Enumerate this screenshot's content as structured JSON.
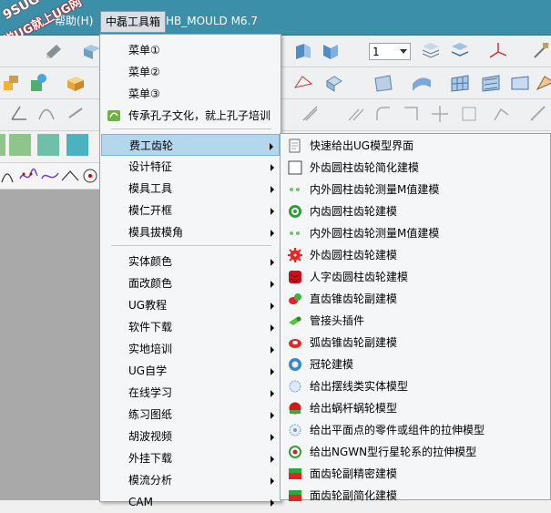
{
  "watermark": {
    "brand": "9SUG",
    "slogan": "学UG就上UG网"
  },
  "menubar": {
    "help": "帮助(H)",
    "toolbox": "中磊工具箱",
    "title": "HB_MOULD M6.7"
  },
  "toolbar": {
    "layer_value": "1"
  },
  "swatch_colors": [
    "#8fc58b",
    "#6ec0a8",
    "#4ab2c0",
    "#5aa8d0"
  ],
  "main_menu": {
    "top_items": [
      "菜单①",
      "菜单②",
      "菜单③"
    ],
    "promo": "传承孔子文化，就上孔子培训",
    "group1": [
      {
        "label": "费工齿轮",
        "highlight": true
      },
      {
        "label": "设计特征"
      },
      {
        "label": "模具工具"
      },
      {
        "label": "模仁开框"
      },
      {
        "label": "模具拔模角"
      }
    ],
    "group2": [
      {
        "label": "实体颜色"
      },
      {
        "label": "面改颜色"
      },
      {
        "label": "UG教程"
      },
      {
        "label": "软件下载"
      },
      {
        "label": "实地培训"
      },
      {
        "label": "UG自学"
      },
      {
        "label": "在线学习"
      },
      {
        "label": "练习图纸"
      },
      {
        "label": "胡波视频"
      },
      {
        "label": "外挂下载"
      },
      {
        "label": "模流分析"
      },
      {
        "label": "CAM"
      }
    ]
  },
  "sub_menu": [
    {
      "label": "快速给出UG模型界面",
      "icon": "window-icon"
    },
    {
      "label": "外齿圆柱齿轮简化建模",
      "icon": "square-icon"
    },
    {
      "label": "内外圆柱齿轮测量M值建模",
      "icon": "dots-icon"
    },
    {
      "label": "内齿圆柱齿轮建模",
      "icon": "ring-gear-icon"
    },
    {
      "label": "内外圆柱齿轮测量M值建模",
      "icon": "dots-icon"
    },
    {
      "label": "外齿圆柱齿轮建模",
      "icon": "red-gear-icon"
    },
    {
      "label": "人字齿圆柱齿轮建模",
      "icon": "herringbone-gear-icon"
    },
    {
      "label": "直齿锥齿轮副建模",
      "icon": "bevel-gear-icon"
    },
    {
      "label": "管接头插件",
      "icon": "pipe-fitting-icon"
    },
    {
      "label": "弧齿锥齿轮副建模",
      "icon": "spiral-bevel-icon"
    },
    {
      "label": "冠轮建模",
      "icon": "crown-gear-icon"
    },
    {
      "label": "给出摆线类实体模型",
      "icon": "cycloid-gear-icon"
    },
    {
      "label": "给出蜗杆蜗轮模型",
      "icon": "worm-gear-icon"
    },
    {
      "label": "给出平面点的零件或组件的拉伸模型",
      "icon": "gear-outline-icon"
    },
    {
      "label": "给出NGWN型行星轮系的拉伸模型",
      "icon": "planetary-gear-icon"
    },
    {
      "label": "面齿轮副精密建模",
      "icon": "face-gear-icon"
    },
    {
      "label": "面齿轮副简化建模",
      "icon": "face-gear-simple-icon"
    }
  ]
}
